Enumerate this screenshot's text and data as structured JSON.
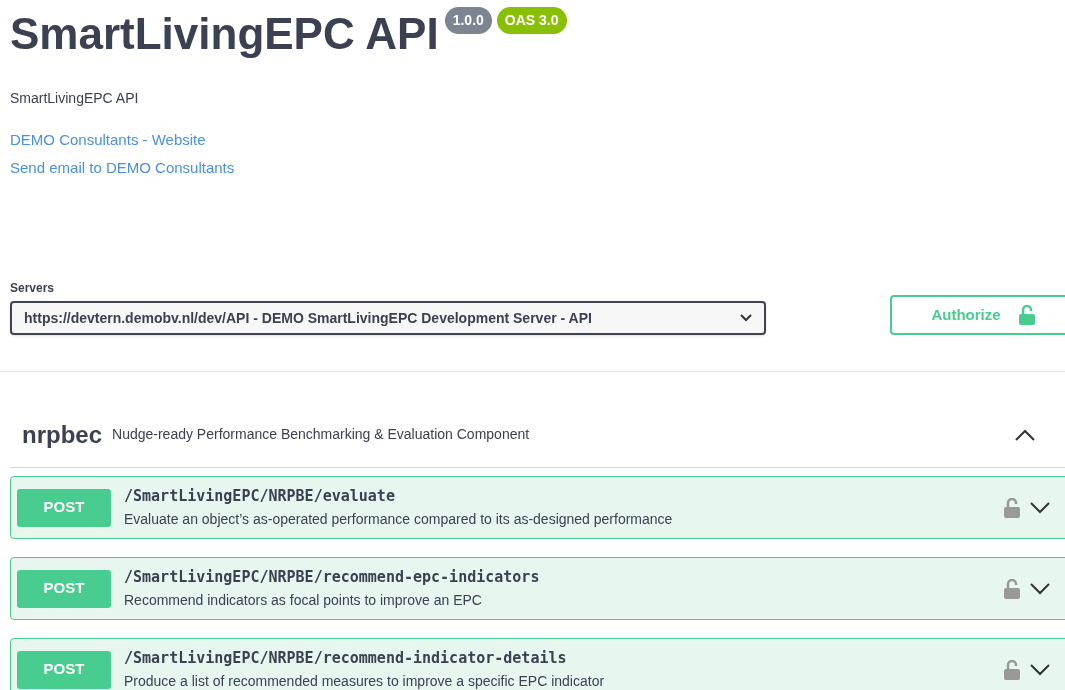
{
  "info": {
    "title": "SmartLivingEPC API",
    "version": "1.0.0",
    "oas": "OAS 3.0",
    "description": "SmartLivingEPC API",
    "links": [
      "DEMO Consultants - Website",
      "Send email to DEMO Consultants"
    ]
  },
  "servers": {
    "label": "Servers",
    "value": "https://devtern.demobv.nl/dev/API - DEMO SmartLivingEPC Development Server - API"
  },
  "authorize": {
    "label": "Authorize"
  },
  "tag": {
    "name": "nrpbec",
    "description": "Nudge-ready Performance Benchmarking & Evaluation Component",
    "expanded": true,
    "operations": [
      {
        "method": "POST",
        "path": "/SmartLivingEPC/NRPBE/evaluate",
        "summary": "Evaluate an object’s as-operated performance compared to its as-designed performance"
      },
      {
        "method": "POST",
        "path": "/SmartLivingEPC/NRPBE/recommend-epc-indicators",
        "summary": "Recommend indicators as focal points to improve an EPC"
      },
      {
        "method": "POST",
        "path": "/SmartLivingEPC/NRPBE/recommend-indicator-details",
        "summary": "Produce a list of recommended measures to improve a specific EPC indicator"
      }
    ]
  }
}
